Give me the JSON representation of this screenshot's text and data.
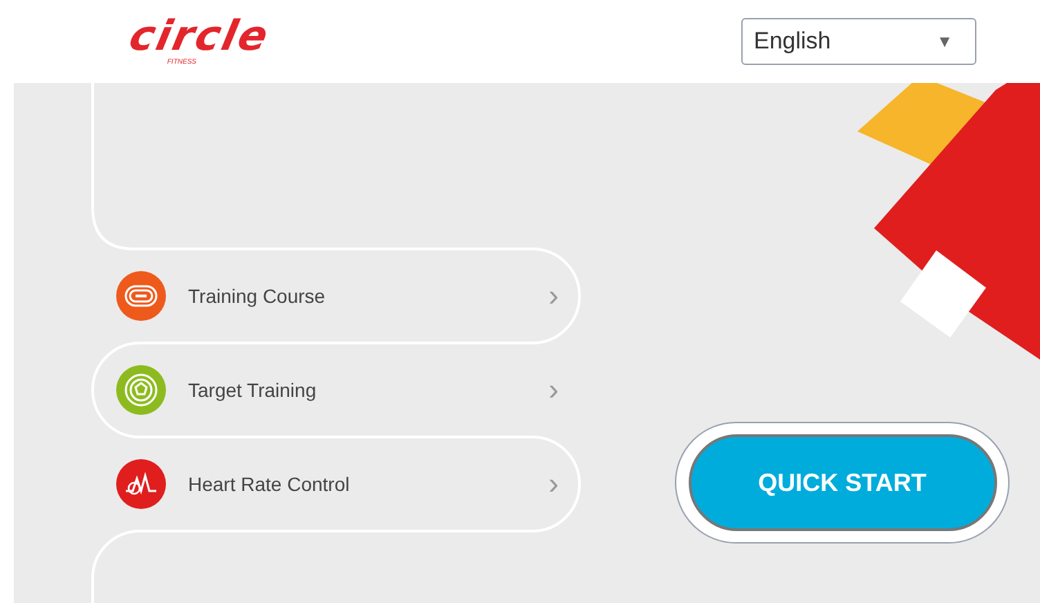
{
  "header": {
    "logo": {
      "wordmark": "circle",
      "tagline": "FITNESS"
    },
    "language_select": {
      "value": "English",
      "caret": "▼"
    }
  },
  "menu": [
    {
      "label": "Training Course",
      "kind": "track",
      "color": "#ee5a1c",
      "chevron": "›"
    },
    {
      "label": "Target Training",
      "kind": "target",
      "color": "#8dbb1f",
      "chevron": "›"
    },
    {
      "label": "Heart Rate Control",
      "kind": "heart",
      "color": "#e01e1e",
      "chevron": "›"
    }
  ],
  "quick_start": {
    "label": "QUICK START"
  }
}
